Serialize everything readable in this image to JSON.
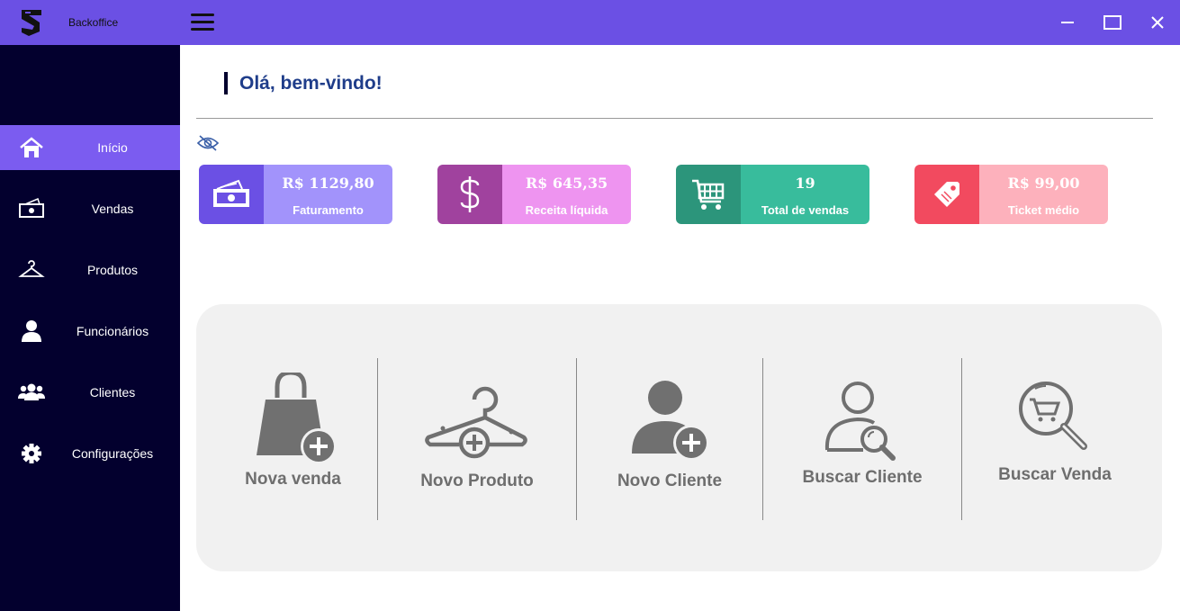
{
  "window": {
    "title": "Backoffice",
    "controls": [
      "minimize-icon",
      "maximize-icon",
      "close-icon"
    ]
  },
  "sidebar": {
    "items": [
      {
        "label": "Início",
        "icon": "home-icon",
        "active": true
      },
      {
        "label": "Vendas",
        "icon": "cash-icon",
        "active": false
      },
      {
        "label": "Produtos",
        "icon": "hanger-icon",
        "active": false
      },
      {
        "label": "Funcionários",
        "icon": "user-icon",
        "active": false
      },
      {
        "label": "Clientes",
        "icon": "users-icon",
        "active": false
      },
      {
        "label": "Configurações",
        "icon": "gear-icon",
        "active": false
      }
    ]
  },
  "main": {
    "greeting": "Olá, bem-vindo!",
    "visibility_icon": "eye-off-icon",
    "cards": [
      {
        "value": "R$ 1129,80",
        "label": "Faturamento",
        "icon": "money-icon",
        "icon_bg": "#6b50e4",
        "body_bg": "#a293fb"
      },
      {
        "value": "R$ 645,35",
        "label": "Receita líquida",
        "icon": "dollar-icon",
        "icon_bg": "#a0429e",
        "body_bg": "#ee94f0"
      },
      {
        "value": "19",
        "label": "Total de vendas",
        "icon": "cart-icon",
        "icon_bg": "#2c957b",
        "body_bg": "#38bc9c"
      },
      {
        "value": "R$ 99,00",
        "label": "Ticket médio",
        "icon": "tag-icon",
        "icon_bg": "#f24a5f",
        "body_bg": "#fdb1bc"
      }
    ],
    "actions": [
      {
        "label": "Nova venda",
        "icon": "shopping-bag-plus-icon"
      },
      {
        "label": "Novo Produto",
        "icon": "hanger-plus-icon"
      },
      {
        "label": "Novo Cliente",
        "icon": "user-plus-icon"
      },
      {
        "label": "Buscar Cliente",
        "icon": "user-search-icon"
      },
      {
        "label": "Buscar Venda",
        "icon": "cart-search-icon"
      }
    ]
  },
  "colors": {
    "titlebar": "#6b50e4",
    "sidebar": "#03002e",
    "sidebar_active": "#7b5cf0",
    "greeting": "#1f3d8a",
    "panel": "#f1f1f1",
    "action_gray": "#707070"
  }
}
